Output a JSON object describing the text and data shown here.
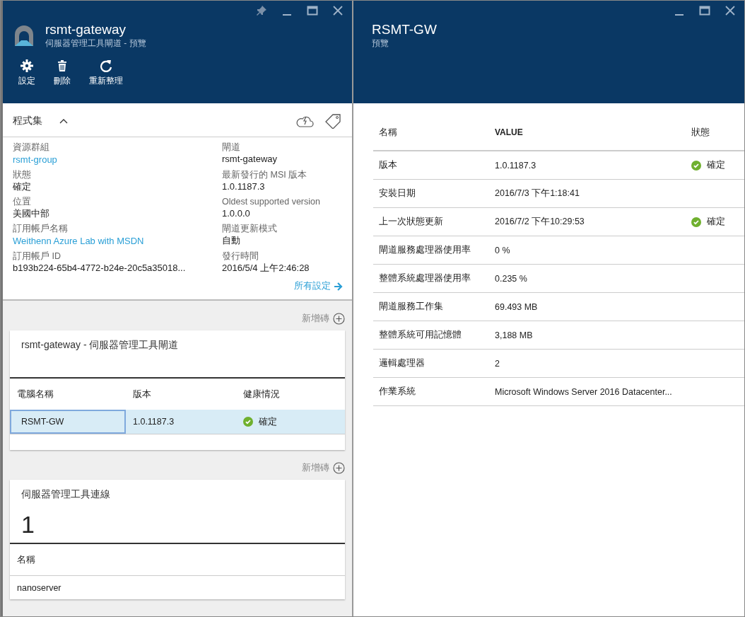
{
  "left_blade": {
    "title": "rsmt-gateway",
    "subtitle": "伺服器管理工具閘道 - 預覽",
    "commands": [
      {
        "kind": "settings",
        "label": "設定"
      },
      {
        "kind": "delete",
        "label": "刪除"
      },
      {
        "kind": "refresh",
        "label": "重新整理"
      }
    ],
    "essentials": {
      "title": "程式集",
      "expanded": true,
      "fields": [
        {
          "label": "資源群組",
          "value": "rsmt-group",
          "link": true
        },
        {
          "label": "閘道",
          "value": "rsmt-gateway",
          "link": false
        },
        {
          "label": "狀態",
          "value": "確定",
          "link": false
        },
        {
          "label": "最新發行的 MSI 版本",
          "value": "1.0.1187.3",
          "link": false
        },
        {
          "label": "位置",
          "value": "美國中部",
          "link": false
        },
        {
          "label": "Oldest supported version",
          "value": "1.0.0.0",
          "link": false
        },
        {
          "label": "訂用帳戶名稱",
          "value": "Weithenn Azure Lab with MSDN",
          "link": true
        },
        {
          "label": "閘道更新模式",
          "value": "自動",
          "link": false
        },
        {
          "label": "訂用帳戶 ID",
          "value": "b193b224-65b4-4772-b24e-20c5a35018...",
          "link": false
        },
        {
          "label": "發行時間",
          "value": "2016/5/4 上午2:46:28",
          "link": false
        }
      ],
      "all_settings": "所有設定"
    },
    "tiles": [
      {
        "kind": "table",
        "add_tile": "新增磚",
        "title": "rsmt-gateway - 伺服器管理工具閘道",
        "columns": [
          "電腦名稱",
          "版本",
          "健康情況"
        ],
        "rows": [
          {
            "name": "RSMT-GW",
            "version": "1.0.1187.3",
            "health": "確定",
            "selected": true
          }
        ]
      },
      {
        "kind": "count",
        "add_tile": "新增磚",
        "title": "伺服器管理工具連線",
        "count": "1",
        "columns": [
          "名稱"
        ],
        "rows": [
          {
            "name": "nanoserver",
            "selected": false
          }
        ]
      }
    ]
  },
  "right_blade": {
    "title": "RSMT-GW",
    "subtitle": "預覽",
    "table": {
      "columns": [
        "名稱",
        "VALUE",
        "狀態"
      ],
      "rows": [
        {
          "name": "版本",
          "value": "1.0.1187.3",
          "status": "確定"
        },
        {
          "name": "安裝日期",
          "value": "2016/7/3 下午1:18:41"
        },
        {
          "name": "上一次狀態更新",
          "value": "2016/7/2 下午10:29:53",
          "status": "確定"
        },
        {
          "name": "閘道服務處理器使用率",
          "value": "0 %"
        },
        {
          "name": "整體系統處理器使用率",
          "value": "0.235 %"
        },
        {
          "name": "閘道服務工作集",
          "value": "69.493 MB"
        },
        {
          "name": "整體系統可用記憶體",
          "value": "3,188 MB"
        },
        {
          "name": "邏輯處理器",
          "value": "2"
        },
        {
          "name": "作業系統",
          "value": "Microsoft Windows Server 2016 Datacenter..."
        }
      ]
    }
  }
}
